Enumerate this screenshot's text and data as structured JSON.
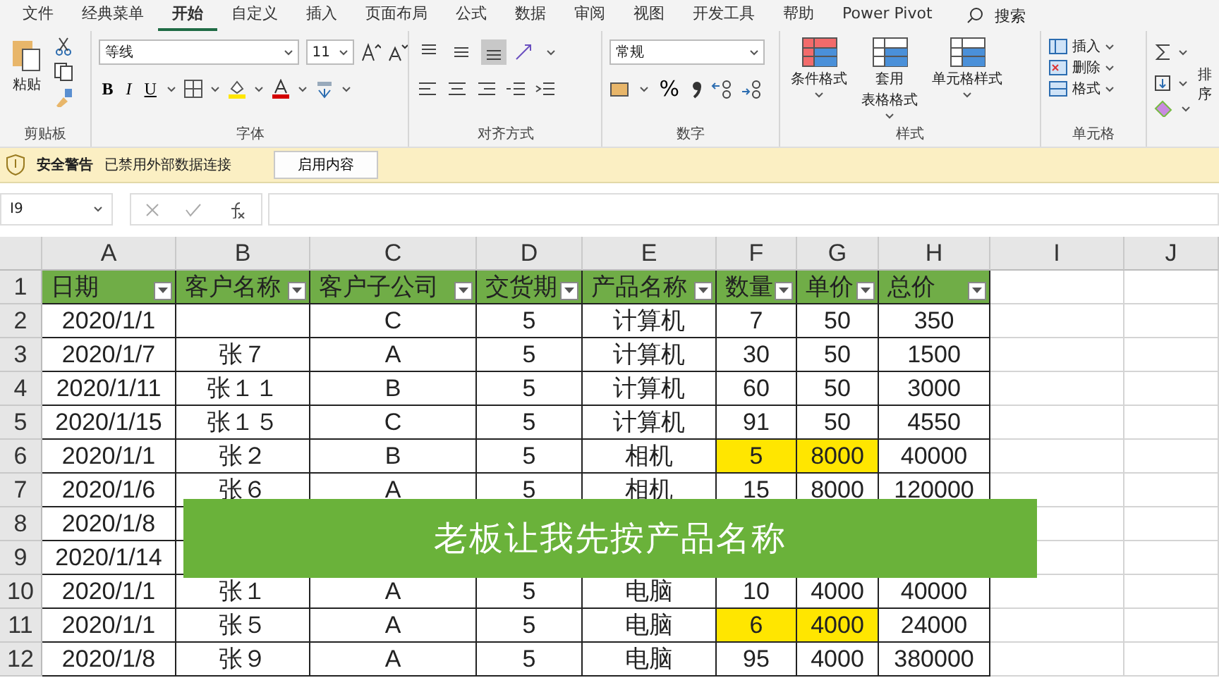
{
  "menu_tabs": [
    {
      "label": "文件",
      "selected": false
    },
    {
      "label": "经典菜单",
      "selected": false
    },
    {
      "label": "开始",
      "selected": true
    },
    {
      "label": "自定义",
      "selected": false
    },
    {
      "label": "插入",
      "selected": false
    },
    {
      "label": "页面布局",
      "selected": false
    },
    {
      "label": "公式",
      "selected": false
    },
    {
      "label": "数据",
      "selected": false
    },
    {
      "label": "审阅",
      "selected": false
    },
    {
      "label": "视图",
      "selected": false
    },
    {
      "label": "开发工具",
      "selected": false
    },
    {
      "label": "帮助",
      "selected": false
    },
    {
      "label": "Power Pivot",
      "selected": false
    }
  ],
  "search": {
    "label": "搜索"
  },
  "ribbon": {
    "clipboard": {
      "paste_label": "粘贴",
      "group_label": "剪贴板"
    },
    "font": {
      "font_name": "等线",
      "font_size": "11",
      "bold": "B",
      "italic": "I",
      "underline": "U",
      "group_label": "字体"
    },
    "alignment": {
      "vertical": [
        {
          "selected": false
        },
        {
          "selected": false
        },
        {
          "selected": true
        }
      ],
      "group_label": "对齐方式"
    },
    "number": {
      "format": "常规",
      "percent": "%",
      "group_label": "数字"
    },
    "styles": {
      "buttons": [
        {
          "lines": [
            "条件格式"
          ]
        },
        {
          "lines": [
            "套用",
            "表格格式"
          ]
        },
        {
          "lines": [
            "单元格样式"
          ]
        }
      ],
      "group_label": "样式"
    },
    "cells": {
      "items": [
        "插入",
        "删除",
        "格式"
      ],
      "group_label": "单元格"
    },
    "editing": {
      "sort_label": "排序"
    }
  },
  "security_bar": {
    "title": "安全警告",
    "message": "已禁用外部数据连接",
    "button": "启用内容"
  },
  "formula_bar": {
    "name_box": "I9"
  },
  "sheet": {
    "columns": [
      "A",
      "B",
      "C",
      "D",
      "E",
      "F",
      "G",
      "H",
      "I",
      "J"
    ],
    "header_row": {
      "number": "1",
      "cells": [
        "日期",
        "客户名称",
        "客户子公司",
        "交货期",
        "产品名称",
        "数量",
        "单价",
        "总价"
      ]
    },
    "rows": [
      {
        "number": "2",
        "cells": [
          {
            "text": "2020/1/1",
            "highlighted": false
          },
          {
            "highlighted": false
          },
          {
            "text": "C",
            "highlighted": false
          },
          {
            "text": "5",
            "highlighted": false
          },
          {
            "text": "计算机",
            "highlighted": false
          },
          {
            "text": "7",
            "highlighted": false
          },
          {
            "text": "50",
            "highlighted": false
          },
          {
            "text": "350",
            "highlighted": false
          }
        ]
      },
      {
        "number": "3",
        "cells": [
          {
            "text": "2020/1/7",
            "highlighted": false
          },
          {
            "text": "张７",
            "highlighted": false
          },
          {
            "text": "A",
            "highlighted": false
          },
          {
            "text": "5",
            "highlighted": false
          },
          {
            "text": "计算机",
            "highlighted": false
          },
          {
            "text": "30",
            "highlighted": false
          },
          {
            "text": "50",
            "highlighted": false
          },
          {
            "text": "1500",
            "highlighted": false
          }
        ]
      },
      {
        "number": "4",
        "cells": [
          {
            "text": "2020/1/11",
            "highlighted": false
          },
          {
            "text": "张１１",
            "highlighted": false
          },
          {
            "text": "B",
            "highlighted": false
          },
          {
            "text": "5",
            "highlighted": false
          },
          {
            "text": "计算机",
            "highlighted": false
          },
          {
            "text": "60",
            "highlighted": false
          },
          {
            "text": "50",
            "highlighted": false
          },
          {
            "text": "3000",
            "highlighted": false
          }
        ]
      },
      {
        "number": "5",
        "cells": [
          {
            "text": "2020/1/15",
            "highlighted": false
          },
          {
            "text": "张１５",
            "highlighted": false
          },
          {
            "text": "C",
            "highlighted": false
          },
          {
            "text": "5",
            "highlighted": false
          },
          {
            "text": "计算机",
            "highlighted": false
          },
          {
            "text": "91",
            "highlighted": false
          },
          {
            "text": "50",
            "highlighted": false
          },
          {
            "text": "4550",
            "highlighted": false
          }
        ]
      },
      {
        "number": "6",
        "cells": [
          {
            "text": "2020/1/1",
            "highlighted": false
          },
          {
            "text": "张２",
            "highlighted": false
          },
          {
            "text": "B",
            "highlighted": false
          },
          {
            "text": "5",
            "highlighted": false
          },
          {
            "text": "相机",
            "highlighted": false
          },
          {
            "text": "5",
            "highlighted": true
          },
          {
            "text": "8000",
            "highlighted": true
          },
          {
            "text": "40000",
            "highlighted": false
          }
        ]
      },
      {
        "number": "7",
        "cells": [
          {
            "text": "2020/1/6",
            "highlighted": false
          },
          {
            "text": "张６",
            "highlighted": false
          },
          {
            "text": "A",
            "highlighted": false
          },
          {
            "text": "5",
            "highlighted": false
          },
          {
            "text": "相机",
            "highlighted": false
          },
          {
            "text": "15",
            "highlighted": false
          },
          {
            "text": "8000",
            "highlighted": false
          },
          {
            "text": "120000",
            "highlighted": false
          }
        ]
      },
      {
        "number": "8",
        "cells": [
          {
            "text": "2020/1/8",
            "highlighted": false
          }
        ]
      },
      {
        "number": "9",
        "cells": [
          {
            "text": "2020/1/14",
            "highlighted": false
          }
        ]
      },
      {
        "number": "10",
        "cells": [
          {
            "text": "2020/1/1",
            "highlighted": false
          },
          {
            "text": "张１",
            "highlighted": false
          },
          {
            "text": "A",
            "highlighted": false
          },
          {
            "text": "5",
            "highlighted": false
          },
          {
            "text": "电脑",
            "highlighted": false
          },
          {
            "text": "10",
            "highlighted": false
          },
          {
            "text": "4000",
            "highlighted": false
          },
          {
            "text": "40000",
            "highlighted": false
          }
        ]
      },
      {
        "number": "11",
        "cells": [
          {
            "text": "2020/1/1",
            "highlighted": false
          },
          {
            "text": "张５",
            "highlighted": false
          },
          {
            "text": "A",
            "highlighted": false
          },
          {
            "text": "5",
            "highlighted": false
          },
          {
            "text": "电脑",
            "highlighted": false
          },
          {
            "text": "6",
            "highlighted": true
          },
          {
            "text": "4000",
            "highlighted": true
          },
          {
            "text": "24000",
            "highlighted": false
          }
        ]
      },
      {
        "number": "12",
        "cells": [
          {
            "text": "2020/1/8",
            "highlighted": false
          },
          {
            "text": "张９",
            "highlighted": false
          },
          {
            "text": "A",
            "highlighted": false
          },
          {
            "text": "5",
            "highlighted": false
          },
          {
            "text": "电脑",
            "highlighted": false
          },
          {
            "text": "95",
            "highlighted": false
          },
          {
            "text": "4000",
            "highlighted": false
          },
          {
            "text": "380000",
            "highlighted": false
          }
        ]
      }
    ]
  },
  "caption": "老板让我先按产品名称"
}
